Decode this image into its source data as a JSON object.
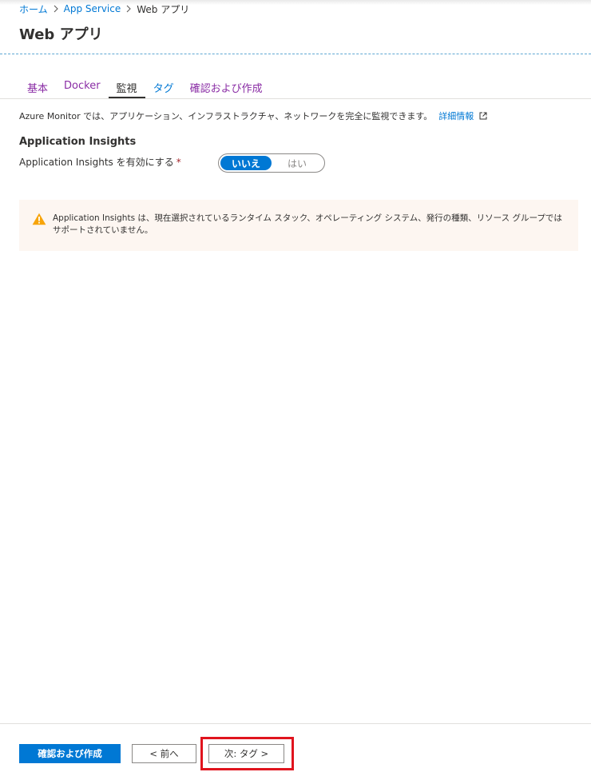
{
  "breadcrumb": {
    "home": "ホーム",
    "app_service": "App Service",
    "current": "Web アプリ"
  },
  "page": {
    "title": "Web アプリ"
  },
  "tabs": [
    {
      "label": "基本",
      "active": false
    },
    {
      "label": "Docker",
      "active": false
    },
    {
      "label": "監視",
      "active": true
    },
    {
      "label": "タグ",
      "active": false
    },
    {
      "label": "確認および作成",
      "active": false
    }
  ],
  "monitor": {
    "description": "Azure Monitor では、アプリケーション、インフラストラクチャ、ネットワークを完全に監視できます。",
    "learn_more": "詳細情報"
  },
  "app_insights": {
    "section_title": "Application Insights",
    "field_label": "Application Insights を有効にする",
    "required_mark": "*",
    "toggle_no": "いいえ",
    "toggle_yes": "はい",
    "selected": "いいえ"
  },
  "warning": {
    "text": "Application Insights は、現在選択されているランタイム スタック、オペレーティング システム、発行の種類、リソース グループではサポートされていません。",
    "icon": "warning-triangle-icon"
  },
  "footer": {
    "review_create": "確認および作成",
    "previous": "< 前へ",
    "next": "次: タグ >"
  },
  "colors": {
    "accent": "#0078d4",
    "tab_link": "#8a2da5",
    "highlight": "#e0141e",
    "warning_bg": "#fdf6f1",
    "warning_icon": "#f7a40a"
  }
}
